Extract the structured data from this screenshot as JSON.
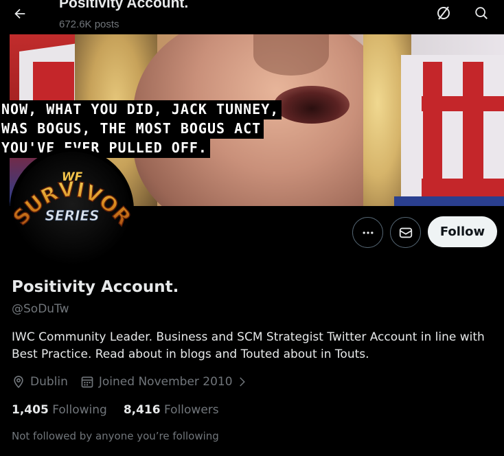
{
  "header": {
    "title": "Positivity Account.",
    "post_count": "672.6K posts",
    "icons": [
      "back-arrow-icon",
      "grok-icon",
      "search-icon"
    ]
  },
  "banner": {
    "quote_lines": [
      "NOW, WHAT YOU DID, JACK TUNNEY,",
      "WAS BOGUS, THE MOST BOGUS ACT",
      "YOU'VE EVER PULLED OFF."
    ]
  },
  "avatar": {
    "logo_text_top": "WF",
    "logo_text_main": "SURVIVOR",
    "logo_text_sub": "SERIES"
  },
  "actions": {
    "more_icon": "more-icon",
    "message_icon": "mail-icon",
    "follow_label": "Follow"
  },
  "profile": {
    "name": "Positivity Account.",
    "handle": "@SoDuTw",
    "bio": "IWC Community Leader. Business and SCM Strategist Twitter Account in line with Best Practice. Read about in blogs and Touted about in Touts.",
    "location": "Dublin",
    "joined": "Joined November 2010",
    "following_count": "1,405",
    "following_label": "Following",
    "followers_count": "8,416",
    "followers_label": "Followers",
    "mutual_note": "Not followed by anyone you’re following"
  },
  "colors": {
    "background": "#000000",
    "text_primary": "#e7e9ea",
    "text_secondary": "#71767b",
    "follow_bg": "#eff3f4",
    "border": "#536471"
  }
}
